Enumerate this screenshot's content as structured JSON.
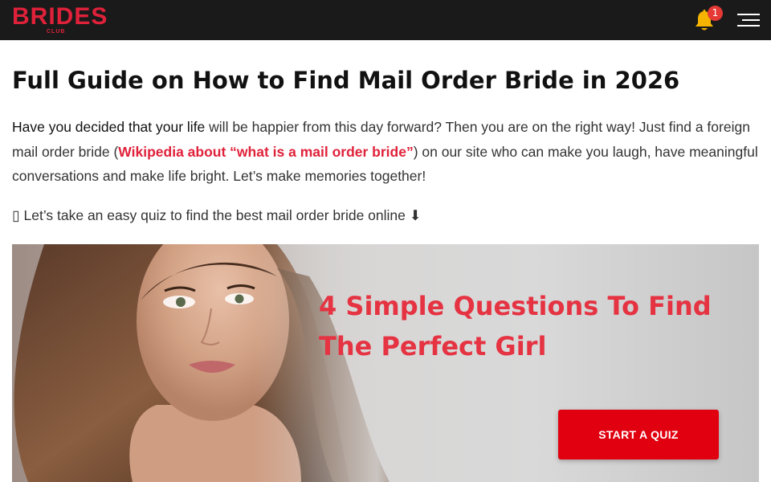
{
  "header": {
    "logo_text": "BRIDES",
    "logo_subtext": "CLUB",
    "notification_count": "1",
    "icons": [
      "bell-icon",
      "hamburger-menu-icon"
    ],
    "background_color": "#1a1a1a",
    "brand_color": "#e0213a"
  },
  "article": {
    "title": "Full Guide on How to Find Mail Order Bride in 2026",
    "intro_part1": "Have you decided that your life",
    "intro_part2": " will be happier from this day forward? Then you are on the right way! Just find a foreign mail order bride (",
    "intro_link": "Wikipedia about “what is a mail order bride”",
    "intro_part3": ") on our site who can make you laugh, have meaningful conversations and make life bright. Let’s make memories together!",
    "quiz_prompt_icon": "▯",
    "quiz_prompt": " Let’s take an easy quiz to find the best mail order bride online ⬇"
  },
  "banner": {
    "heading": "4 Simple Questions To Find The Perfect Girl",
    "button_label": "START A QUIZ",
    "heading_color": "#e53342",
    "button_color": "#e0000f"
  }
}
